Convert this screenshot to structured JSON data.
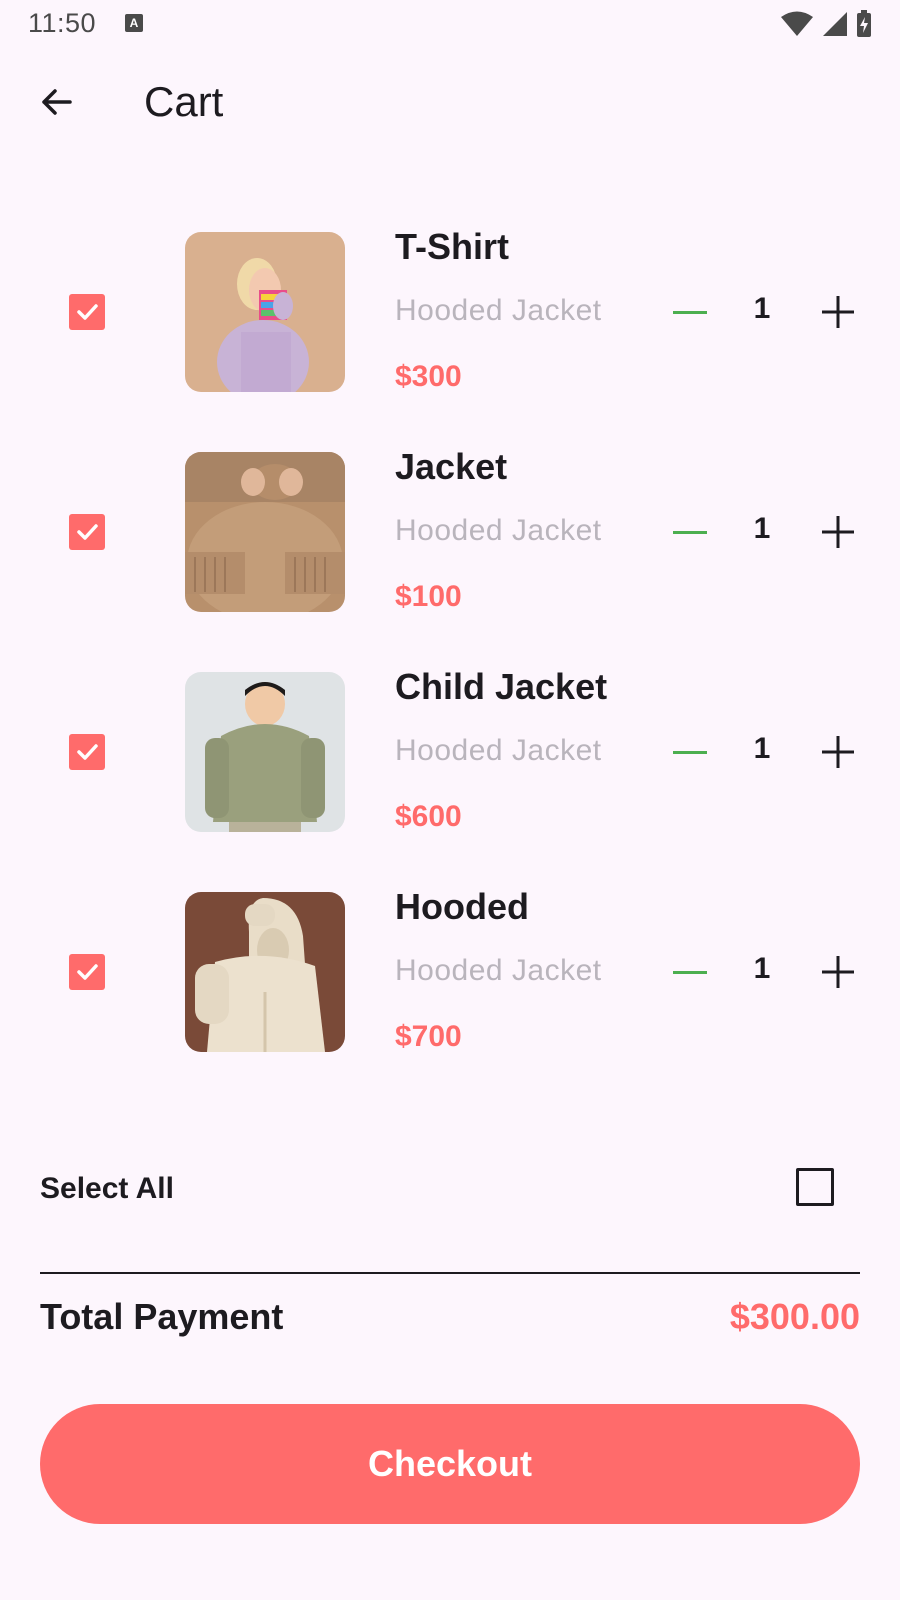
{
  "status_bar": {
    "time": "11:50",
    "icons": [
      "accessibility-a-icon",
      "wifi-icon",
      "signal-icon",
      "battery-charging-icon"
    ]
  },
  "header": {
    "title": "Cart",
    "back_icon": "arrow-left-icon"
  },
  "cart": {
    "items": [
      {
        "name": "T-Shirt",
        "subtitle": "Hooded Jacket",
        "price": "$300",
        "quantity": "1",
        "checked": true
      },
      {
        "name": "Jacket",
        "subtitle": "Hooded Jacket",
        "price": "$100",
        "quantity": "1",
        "checked": true
      },
      {
        "name": "Child Jacket",
        "subtitle": "Hooded Jacket",
        "price": "$600",
        "quantity": "1",
        "checked": true
      },
      {
        "name": "Hooded",
        "subtitle": "Hooded Jacket",
        "price": "$700",
        "quantity": "1",
        "checked": true
      }
    ]
  },
  "select_all": {
    "label": "Select All",
    "checked": false
  },
  "total": {
    "label": "Total Payment",
    "value": "$300.00"
  },
  "checkout": {
    "label": "Checkout"
  },
  "colors": {
    "accent": "#ff6b6b",
    "background": "#fdf6fd",
    "minus": "#4caf50",
    "subtitle": "#b9b4bc",
    "text": "#1d1b20"
  }
}
